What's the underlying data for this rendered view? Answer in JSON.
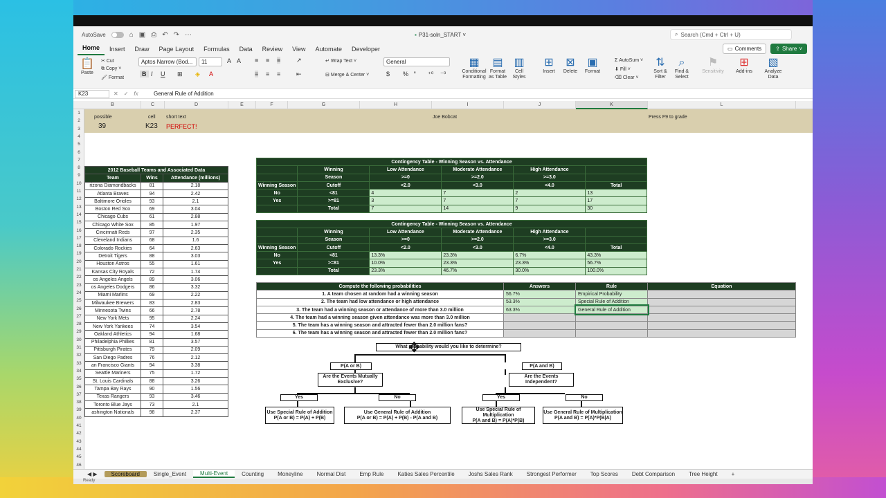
{
  "quick_access": {
    "autosave": "AutoSave",
    "doc_title": "P31-soln_START",
    "search_placeholder": "Search (Cmd + Ctrl + U)"
  },
  "menu_tabs": [
    "Home",
    "Insert",
    "Draw",
    "Page Layout",
    "Formulas",
    "Data",
    "Review",
    "View",
    "Automate",
    "Developer"
  ],
  "buttons": {
    "comments": "Comments",
    "share": "Share"
  },
  "ribbon": {
    "paste": "Paste",
    "cut": "Cut",
    "copy": "Copy",
    "format": "Format",
    "font_name": "Aptos Narrow (Bod...",
    "font_size": "11",
    "wrap_text": "Wrap Text",
    "merge_center": "Merge & Center",
    "number_format": "General",
    "conditional_formatting": "Conditional Formatting",
    "format_as_table": "Format as Table",
    "cell_styles": "Cell Styles",
    "insert": "Insert",
    "delete": "Delete",
    "format_cells": "Format",
    "autosum": "AutoSum",
    "fill": "Fill",
    "clear": "Clear",
    "sort_filter": "Sort & Filter",
    "find_select": "Find & Select",
    "sensitivity": "Sensitivity",
    "add_ins": "Add-ins",
    "analyze_data": "Analyze Data"
  },
  "formula_bar": {
    "name_box": "K23",
    "formula": "General Rule of Addition"
  },
  "columns": [
    "B",
    "C",
    "D",
    "E",
    "F",
    "G",
    "H",
    "I",
    "J",
    "K",
    "L"
  ],
  "rows": [
    "1",
    "2",
    "3",
    "4",
    "5",
    "6",
    "7",
    "8",
    "9",
    "10",
    "11",
    "12",
    "13",
    "14",
    "15",
    "16",
    "17",
    "18",
    "19",
    "20",
    "21",
    "22",
    "23",
    "24",
    "25",
    "26",
    "27",
    "28",
    "29",
    "30",
    "31",
    "32",
    "33",
    "34",
    "35",
    "36",
    "37",
    "38",
    "39",
    "40",
    "41",
    "42",
    "43",
    "44",
    "45",
    "46"
  ],
  "scoreboard": {
    "possible_label": "possible",
    "possible_value": "39",
    "cell_label": "cell",
    "cell_value": "K23",
    "short_text_label": "short text",
    "short_text_value": "PERFECT!",
    "name": "Joe Bobcat",
    "hint": "Press F9 to grade"
  },
  "team_table": {
    "title": "2012 Baseball Teams and Associated Data",
    "headers": [
      "Team",
      "Wins",
      "Attendance (millions)"
    ],
    "rows": [
      [
        "rizona Diamondbacks",
        "81",
        "2.18"
      ],
      [
        "Atlanta Braves",
        "94",
        "2.42"
      ],
      [
        "Baltimore Orioles",
        "93",
        "2.1"
      ],
      [
        "Boston Red Sox",
        "69",
        "3.04"
      ],
      [
        "Chicago Cubs",
        "61",
        "2.88"
      ],
      [
        "Chicago White Sox",
        "85",
        "1.97"
      ],
      [
        "Cincinnati Reds",
        "97",
        "2.35"
      ],
      [
        "Cleveland Indians",
        "68",
        "1.6"
      ],
      [
        "Colorado Rockies",
        "64",
        "2.63"
      ],
      [
        "Detroit Tigers",
        "88",
        "3.03"
      ],
      [
        "Houston Astros",
        "55",
        "1.61"
      ],
      [
        "Kansas City Royals",
        "72",
        "1.74"
      ],
      [
        "os Angeles Angels",
        "89",
        "3.06"
      ],
      [
        "os Angeles Dodgers",
        "86",
        "3.32"
      ],
      [
        "Miami Marlins",
        "69",
        "2.22"
      ],
      [
        "Milwaukee Brewers",
        "83",
        "2.83"
      ],
      [
        "Minnesota Twins",
        "66",
        "2.78"
      ],
      [
        "New York Mets",
        "95",
        "2.24"
      ],
      [
        "New York Yankees",
        "74",
        "3.54"
      ],
      [
        "Oakland Athletics",
        "94",
        "1.68"
      ],
      [
        "Philadelphia Phillies",
        "81",
        "3.57"
      ],
      [
        "Pittsburgh Pirates",
        "79",
        "2.09"
      ],
      [
        "San Diego Padres",
        "76",
        "2.12"
      ],
      [
        "an Francisco Giants",
        "94",
        "3.38"
      ],
      [
        "Seattle Mariners",
        "75",
        "1.72"
      ],
      [
        "St. Louis Cardinals",
        "88",
        "3.26"
      ],
      [
        "Tampa Bay Rays",
        "90",
        "1.56"
      ],
      [
        "Texas Rangers",
        "93",
        "3.46"
      ],
      [
        "Toronto Blue Jays",
        "73",
        "2.1"
      ],
      [
        "ashington Nationals",
        "98",
        "2.37"
      ]
    ]
  },
  "contingency1": {
    "title": "Contingency Table - Winning Season vs. Attendance",
    "h1": [
      "Winning",
      "Low Attendance",
      "Moderate Attendance",
      "High Attendance",
      ""
    ],
    "h2": [
      "Season",
      ">=0",
      ">=2.0",
      ">=3.0",
      ""
    ],
    "h3": [
      "Winning Season",
      "Cutoff",
      "<2.0",
      "<3.0",
      "<4.0",
      "Total"
    ],
    "rows": [
      [
        "No",
        "<81",
        "4",
        "7",
        "2",
        "13"
      ],
      [
        "Yes",
        ">=81",
        "3",
        "7",
        "7",
        "17"
      ],
      [
        "",
        "Total",
        "7",
        "14",
        "9",
        "30"
      ]
    ]
  },
  "contingency2": {
    "title": "Contingency Table - Winning Season vs. Attendance",
    "h1": [
      "Winning",
      "Low Attendance",
      "Moderate Attendance",
      "High Attendance",
      ""
    ],
    "h2": [
      "Season",
      ">=0",
      ">=2.0",
      ">=3.0",
      ""
    ],
    "h3": [
      "Winning Season",
      "Cutoff",
      "<2.0",
      "<3.0",
      "<4.0",
      "Total"
    ],
    "rows": [
      [
        "No",
        "<81",
        "13.3%",
        "23.3%",
        "6.7%",
        "43.3%"
      ],
      [
        "Yes",
        ">=81",
        "10.0%",
        "23.3%",
        "23.3%",
        "56.7%"
      ],
      [
        "",
        "Total",
        "23.3%",
        "46.7%",
        "30.0%",
        "100.0%"
      ]
    ]
  },
  "prob_table": {
    "headers": [
      "Compute the following probabilities",
      "Answers",
      "Rule",
      "Equation"
    ],
    "rows": [
      [
        "1. A team chosen at random had a winning season",
        "56.7%",
        "Empirical Probability",
        ""
      ],
      [
        "2. The team had low attendance or high attendance",
        "53.3%",
        "Special Rule of Addition",
        ""
      ],
      [
        "3. The team had a winning season or attendance of more than 3.0 million",
        "63.3%",
        "General Rule of Addition",
        ""
      ],
      [
        "4. The team had a winning season given attendance was more than 3.0 million",
        "",
        "",
        ""
      ],
      [
        "5. The team has a winning season and attracted fewer than 2.0 million fans?",
        "",
        "",
        ""
      ],
      [
        "6. The team has a winning season and attracted fewer than 2.0 million fans?",
        "",
        "",
        ""
      ]
    ]
  },
  "tree": {
    "root": "What probability would you like to determine?",
    "or": "P(A or B)",
    "and": "P(A and B)",
    "q_mutex": "Are the Events Mutually Exclusive?",
    "q_indep": "Are the Events Independent?",
    "yes": "Yes",
    "no": "No",
    "leaf1": [
      "Use Special Rule of Addition",
      "P(A or B) = P(A) + P(B)"
    ],
    "leaf2": [
      "Use General Rule of Addition",
      "P(A or B) = P(A) + P(B) - P(A and B)"
    ],
    "leaf3": [
      "Use Special Rule of Multiplication",
      "P(A and B) = P(A)*P(B)"
    ],
    "leaf4": [
      "Use General Rule of Multiplication",
      "P(A and B) = P(A)*P(B|A)"
    ]
  },
  "sheet_tabs": [
    "Scoreboard",
    "Single_Event",
    "Multi-Event",
    "Counting",
    "Moneyline",
    "Normal Dist",
    "Emp Rule",
    "Katies Sales Percentile",
    "Joshs Sales Rank",
    "Strongest Performer",
    "Top Scores",
    "Debt Comparison",
    "Tree Height"
  ],
  "status": {
    "text": "Ready"
  }
}
